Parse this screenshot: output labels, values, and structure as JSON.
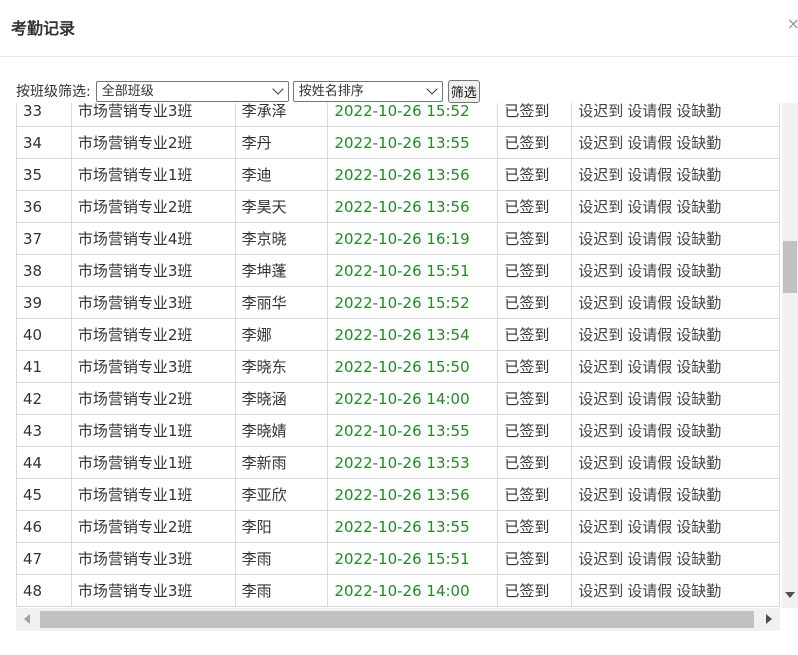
{
  "dialog": {
    "title": "考勤记录",
    "close": "×"
  },
  "filter": {
    "label": "按班级筛选:",
    "class_select": "全部班级",
    "sort_select": "按姓名排序",
    "button": "筛选"
  },
  "actions": {
    "late": "设迟到",
    "leave": "设请假",
    "absent": "设缺勤"
  },
  "rows": [
    {
      "no": "33",
      "class": "市场营销专业3班",
      "name": "李承泽",
      "time": "2022-10-26 15:52",
      "status": "已签到"
    },
    {
      "no": "34",
      "class": "市场营销专业2班",
      "name": "李丹",
      "time": "2022-10-26 13:55",
      "status": "已签到"
    },
    {
      "no": "35",
      "class": "市场营销专业1班",
      "name": "李迪",
      "time": "2022-10-26 13:56",
      "status": "已签到"
    },
    {
      "no": "36",
      "class": "市场营销专业2班",
      "name": "李昊天",
      "time": "2022-10-26 13:56",
      "status": "已签到"
    },
    {
      "no": "37",
      "class": "市场营销专业4班",
      "name": "李京晓",
      "time": "2022-10-26 16:19",
      "status": "已签到"
    },
    {
      "no": "38",
      "class": "市场营销专业3班",
      "name": "李坤蓬",
      "time": "2022-10-26 15:51",
      "status": "已签到"
    },
    {
      "no": "39",
      "class": "市场营销专业3班",
      "name": "李丽华",
      "time": "2022-10-26 15:52",
      "status": "已签到"
    },
    {
      "no": "40",
      "class": "市场营销专业2班",
      "name": "李娜",
      "time": "2022-10-26 13:54",
      "status": "已签到"
    },
    {
      "no": "41",
      "class": "市场营销专业3班",
      "name": "李晓东",
      "time": "2022-10-26 15:50",
      "status": "已签到"
    },
    {
      "no": "42",
      "class": "市场营销专业2班",
      "name": "李晓涵",
      "time": "2022-10-26 14:00",
      "status": "已签到"
    },
    {
      "no": "43",
      "class": "市场营销专业1班",
      "name": "李晓婧",
      "time": "2022-10-26 13:55",
      "status": "已签到"
    },
    {
      "no": "44",
      "class": "市场营销专业1班",
      "name": "李新雨",
      "time": "2022-10-26 13:53",
      "status": "已签到"
    },
    {
      "no": "45",
      "class": "市场营销专业1班",
      "name": "李亚欣",
      "time": "2022-10-26 13:56",
      "status": "已签到"
    },
    {
      "no": "46",
      "class": "市场营销专业2班",
      "name": "李阳",
      "time": "2022-10-26 13:55",
      "status": "已签到"
    },
    {
      "no": "47",
      "class": "市场营销专业3班",
      "name": "李雨",
      "time": "2022-10-26 15:51",
      "status": "已签到"
    },
    {
      "no": "48",
      "class": "市场营销专业3班",
      "name": "李雨",
      "time": "2022-10-26 14:00",
      "status": "已签到"
    }
  ]
}
